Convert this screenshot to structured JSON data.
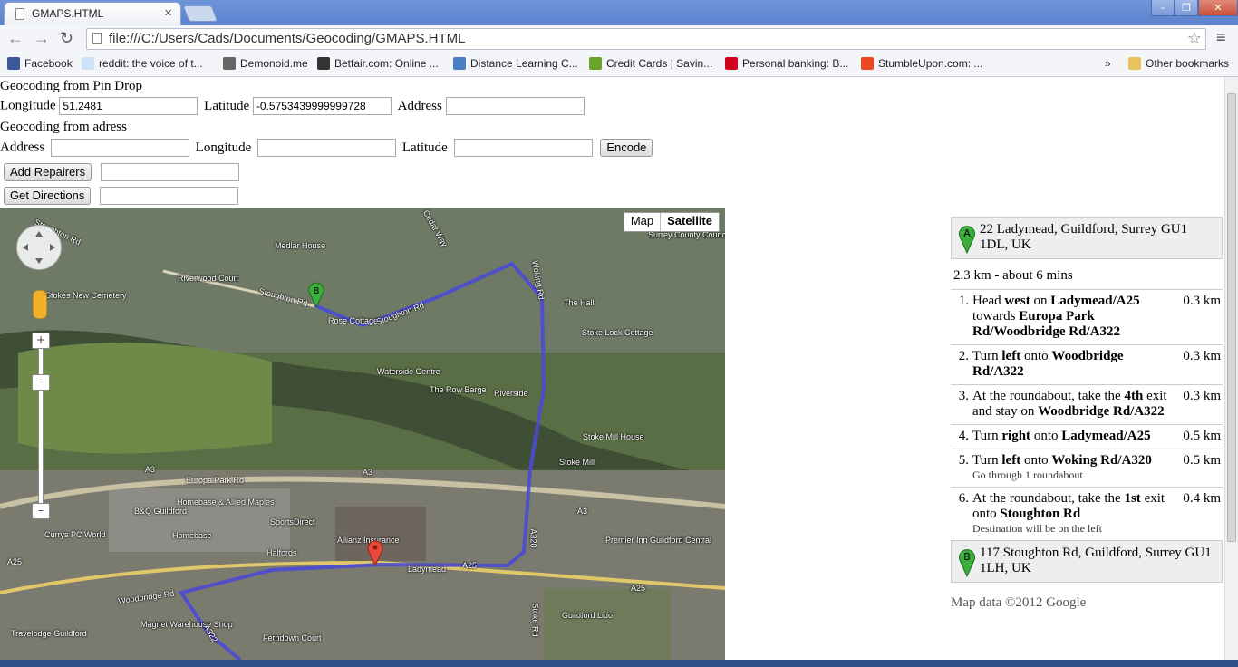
{
  "browser": {
    "tab_title": "GMAPS.HTML",
    "url": "file:///C:/Users/Cads/Documents/Geocoding/GMAPS.HTML",
    "bookmarks": [
      {
        "label": "Facebook",
        "color": "#3b5998"
      },
      {
        "label": "reddit: the voice of t...",
        "color": "#cee3f8"
      },
      {
        "label": "Demonoid.me",
        "color": "#666666"
      },
      {
        "label": "Betfair.com: Online ...",
        "color": "#333333"
      },
      {
        "label": "Distance Learning C...",
        "color": "#4a7fc1"
      },
      {
        "label": "Credit Cards | Savin...",
        "color": "#69a32a"
      },
      {
        "label": "Personal banking: B...",
        "color": "#d0021b"
      },
      {
        "label": "StumbleUpon.com: ...",
        "color": "#eb4924"
      }
    ],
    "more": "»",
    "other_bookmarks": "Other bookmarks"
  },
  "form": {
    "pin_heading": "Geocoding from Pin Drop",
    "longitude_label": "Longitude",
    "longitude_value": "51.2481",
    "latitude_label": "Latitude",
    "latitude_value": "-0.5753439999999728",
    "address_label": "Address",
    "address_value": "",
    "adress_heading": "Geocoding from adress",
    "address2_label": "Address",
    "longitude2_label": "Longitude",
    "latitude2_label": "Latitude",
    "encode_label": "Encode",
    "add_repairers_label": "Add Repairers",
    "get_directions_label": "Get Directions"
  },
  "map": {
    "map_label": "Map",
    "satellite_label": "Satellite",
    "labels": [
      "Stoughton Rd",
      "Medlar House",
      "Riverwood Court",
      "Stoughton Rd",
      "Rose Cottage",
      "Stoughton Rd",
      "Woking Rd",
      "Surrey County Council Depot",
      "The Hall",
      "Stoke Lock Cottage",
      "Waterside Centre",
      "The Row Barge",
      "Riverside",
      "Stoke Mill House",
      "Stoke Mill",
      "A3",
      "A3",
      "A3",
      "Europa Park Rd",
      "B&Q Guildford",
      "Homebase & Allied Maples",
      "SportsDirect",
      "Homebase",
      "Halfords",
      "Currys PC World",
      "Premier Inn Guildford Central",
      "Ladymead",
      "A25",
      "A25",
      "A25",
      "Woodbridge Rd",
      "Magnet Warehouse Shop",
      "Ferndown Court",
      "Travelodge Guildford",
      "Guildford Lido",
      "Stoke Rd",
      "A320",
      "A322",
      "Cedar Way",
      "Stokes New Cemetery",
      "Allianz Insurance"
    ]
  },
  "directions": {
    "start_marker": "A",
    "start_address": "22 Ladymead, Guildford, Surrey GU1 1DL, UK",
    "summary": "2.3 km - about 6 mins",
    "steps": [
      {
        "num": "1.",
        "html": "Head <b>west</b> on <b>Ladymead/A25</b> towards <b>Europa Park Rd/Woodbridge Rd/A322</b>",
        "dist": "0.3 km"
      },
      {
        "num": "2.",
        "html": "Turn <b>left</b> onto <b>Woodbridge Rd/A322</b>",
        "dist": "0.3 km"
      },
      {
        "num": "3.",
        "html": "At the roundabout, take the <b>4th</b> exit and stay on <b>Woodbridge Rd/A322</b>",
        "dist": "0.3 km"
      },
      {
        "num": "4.",
        "html": "Turn <b>right</b> onto <b>Ladymead/A25</b>",
        "dist": "0.5 km"
      },
      {
        "num": "5.",
        "html": "Turn <b>left</b> onto <b>Woking Rd/A320</b><div class='note'>Go through 1 roundabout</div>",
        "dist": "0.5 km"
      },
      {
        "num": "6.",
        "html": "At the roundabout, take the <b>1st</b> exit onto <b>Stoughton Rd</b><div class='note'>Destination will be on the left</div>",
        "dist": "0.4 km"
      }
    ],
    "end_marker": "B",
    "end_address": "117 Stoughton Rd, Guildford, Surrey GU1 1LH, UK",
    "copyright": "Map data ©2012 Google"
  }
}
